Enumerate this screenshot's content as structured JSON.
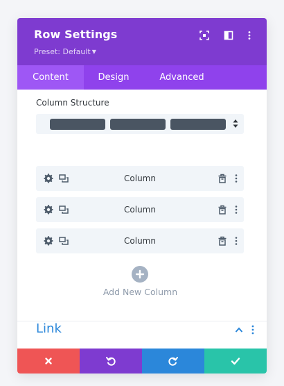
{
  "header": {
    "title": "Row Settings",
    "preset_label": "Preset: Default",
    "icons": [
      "expand-icon",
      "sidebar-toggle-icon",
      "more-vertical-icon"
    ],
    "background": "#7e3bd0"
  },
  "tabs": [
    {
      "label": "Content",
      "active": true
    },
    {
      "label": "Design",
      "active": false
    },
    {
      "label": "Advanced",
      "active": false
    }
  ],
  "content": {
    "column_structure_label": "Column Structure",
    "column_structure_selected_columns": 3,
    "columns": [
      {
        "label": "Column"
      },
      {
        "label": "Column"
      },
      {
        "label": "Column"
      }
    ],
    "column_icons": [
      "gear-icon",
      "duplicate-icon",
      "trash-icon",
      "more-vertical-icon"
    ],
    "add_column_label": "Add New Column"
  },
  "link_section": {
    "title": "Link",
    "expanded": true,
    "accent": "#2b87da"
  },
  "footer": {
    "buttons": [
      {
        "name": "discard",
        "icon": "close-icon",
        "color": "#ef5555"
      },
      {
        "name": "undo",
        "icon": "undo-icon",
        "color": "#7e3bd0"
      },
      {
        "name": "redo",
        "icon": "redo-icon",
        "color": "#2b87da"
      },
      {
        "name": "save",
        "icon": "check-icon",
        "color": "#29c4a9"
      }
    ]
  }
}
